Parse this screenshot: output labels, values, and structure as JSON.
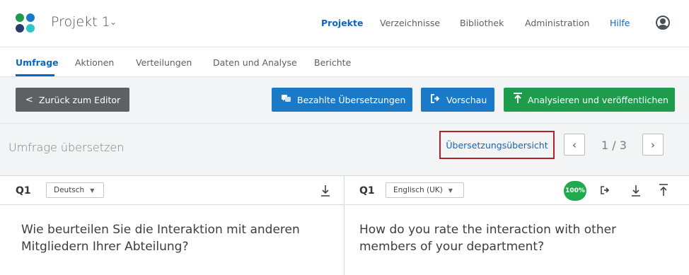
{
  "header": {
    "project_title": "Projekt 1",
    "logo_colors": [
      "#1e9c4b",
      "#1b7ac7",
      "#2a3a6e",
      "#2ec4c9"
    ],
    "nav": [
      "Projekte",
      "Verzeichnisse",
      "Bibliothek",
      "Administration",
      "Hilfe"
    ]
  },
  "tabs": [
    "Umfrage",
    "Aktionen",
    "Verteilungen",
    "Daten und Analyse",
    "Berichte"
  ],
  "toolbar": {
    "back": "Zurück zum Editor",
    "paid_translations": "Bezahlte Übersetzungen",
    "preview": "Vorschau",
    "analyze_publish": "Analysieren und veröffentlichen"
  },
  "translate": {
    "title": "Umfrage übersetzen",
    "overview_link": "Übersetzungsübersicht",
    "pager": "1 / 3"
  },
  "left": {
    "question": "Q1",
    "language": "Deutsch",
    "text": "Wie beurteilen Sie die Interaktion mit anderen Mitgliedern Ihrer Abteilung?"
  },
  "right": {
    "question": "Q1",
    "language": "Englisch (UK)",
    "progress": "100%",
    "text": "How do you rate the interaction with other members of your department?"
  }
}
